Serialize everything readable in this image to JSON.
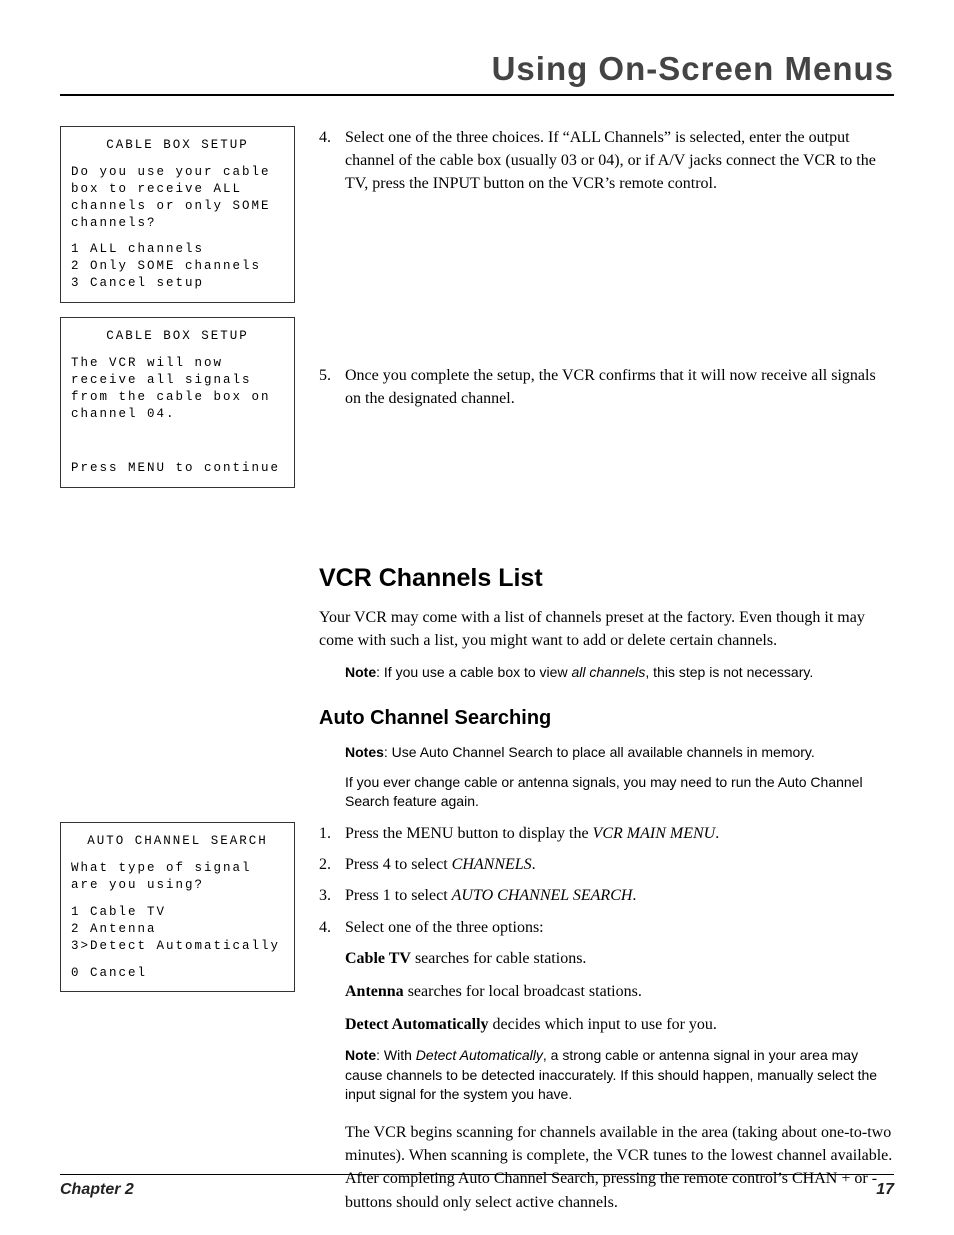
{
  "header": {
    "title": "Using On-Screen Menus"
  },
  "footer": {
    "chapter": "Chapter 2",
    "page": "17"
  },
  "screens": {
    "box1": {
      "title": "CABLE BOX SETUP",
      "prompt": "Do you use your cable box to receive ALL channels or only SOME channels?",
      "opt1": "1 ALL channels",
      "opt2": "2 Only SOME channels",
      "opt3": "3 Cancel setup"
    },
    "box2": {
      "title": "CABLE BOX SETUP",
      "msg": "The VCR will now receive all signals from the cable box on channel 04.",
      "cont": "Press MENU to continue"
    },
    "box3": {
      "title": "AUTO CHANNEL SEARCH",
      "prompt": "What type of signal are you using?",
      "opt1": "1 Cable TV",
      "opt2": "2 Antenna",
      "opt3": "3>Detect Automatically",
      "cancel": "0 Cancel"
    }
  },
  "steps": {
    "s4": {
      "num": "4.",
      "text": "Select one of the three choices. If “ALL Channels” is selected, enter the output channel of the cable box (usually 03 or 04), or if A/V jacks connect the VCR to the TV, press the INPUT button on the VCR’s remote control."
    },
    "s5": {
      "num": "5.",
      "text": "Once you complete the setup, the VCR confirms that it will now receive all signals on the designated channel."
    }
  },
  "vcr_list": {
    "heading": "VCR Channels List",
    "para": "Your VCR may come with a list of channels preset at the factory. Even though it may come with such a list, you might want to add or delete certain channels.",
    "note_label": "Note",
    "note_pre": ": If you use a cable box to view ",
    "note_ital": "all channels",
    "note_post": ", this step is not necessary."
  },
  "auto": {
    "heading": "Auto Channel Searching",
    "notes_label": "Notes",
    "notes1": ": Use Auto Channel Search to place all available channels in memory.",
    "notes2": "If you ever change cable or antenna signals, you may need to run the Auto Channel Search feature again.",
    "s1": {
      "num": "1.",
      "pre": "Press the MENU button to display the ",
      "ital": "VCR MAIN MENU",
      "post": "."
    },
    "s2": {
      "num": "2.",
      "pre": "Press 4 to select ",
      "ital": "CHANNELS",
      "post": "."
    },
    "s3": {
      "num": "3.",
      "pre": "Press 1 to select ",
      "ital": "AUTO CHANNEL SEARCH",
      "post": "."
    },
    "s4": {
      "num": "4.",
      "text": "Select one of the three options:"
    },
    "opt_cable_b": "Cable TV",
    "opt_cable_t": " searches for cable stations.",
    "opt_ant_b": "Antenna",
    "opt_ant_t": " searches for local broadcast stations.",
    "opt_det_b": "Detect Automatically",
    "opt_det_t": " decides which input to use for you.",
    "note2_label": "Note",
    "note2_pre": ": With ",
    "note2_ital": "Detect Automatically",
    "note2_post": ", a strong cable or antenna signal in your area may cause channels to be detected inaccurately. If this should happen, manually select the input signal for the system you have.",
    "scan_para": "The VCR begins scanning for channels available in the area (taking about one-to-two minutes). When scanning is complete, the VCR tunes to the lowest channel available. After completing Auto Channel Search, pressing the remote control’s  CHAN + or - buttons should only select active channels."
  }
}
